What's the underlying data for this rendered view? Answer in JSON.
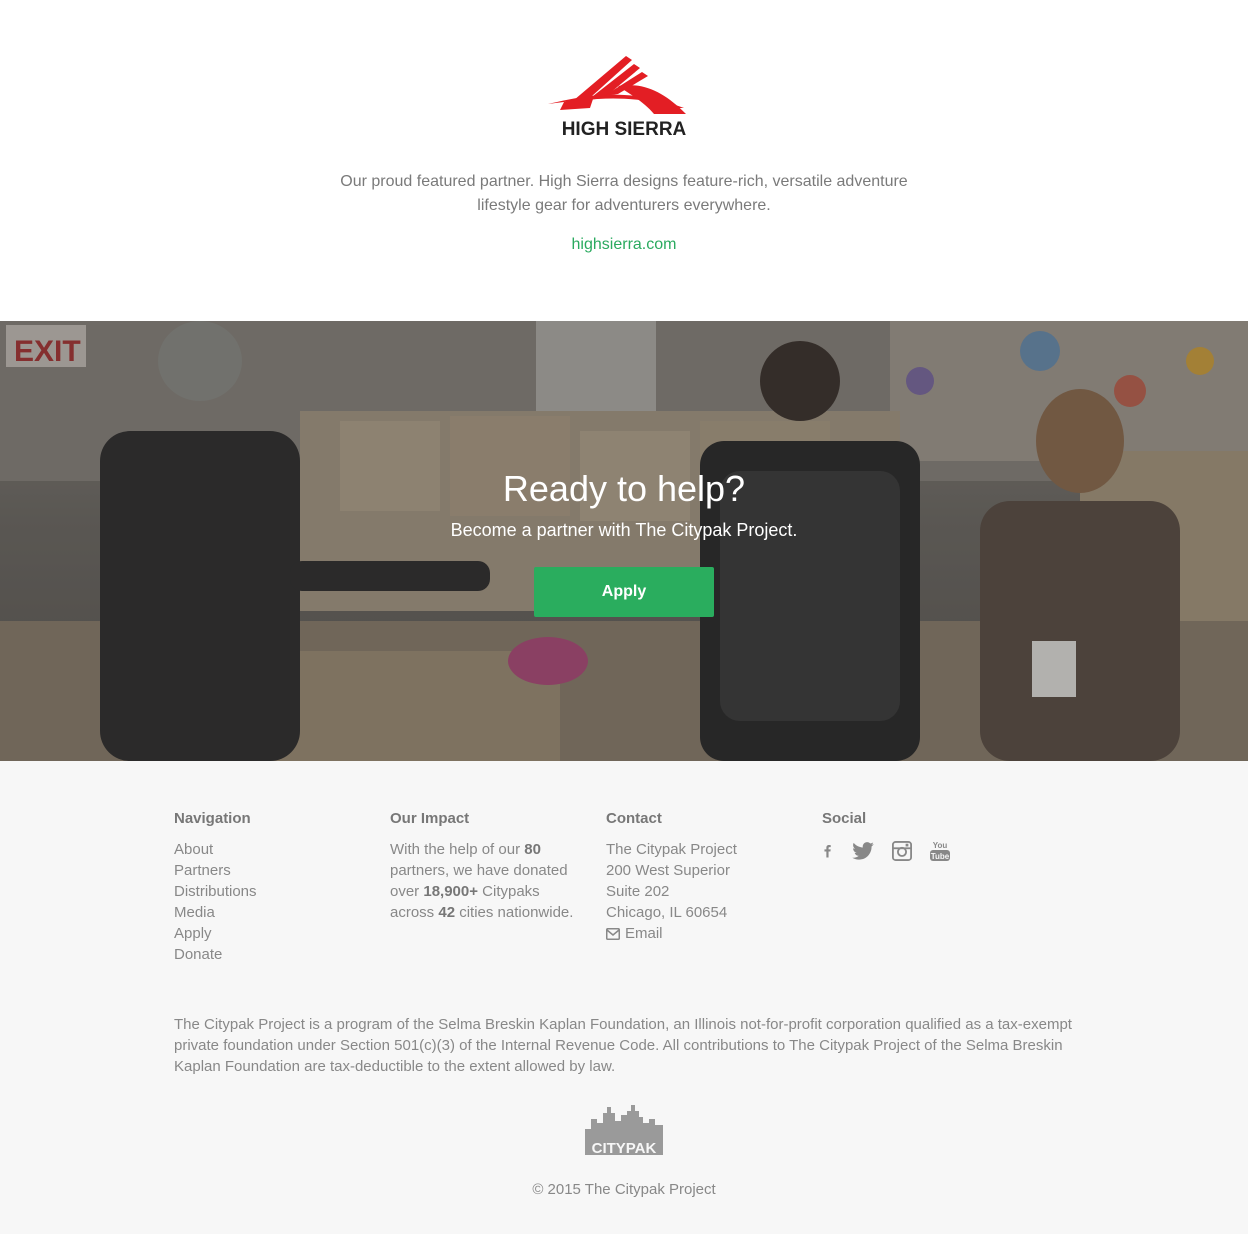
{
  "partner": {
    "logo_text": "HIGH SIERRA",
    "description": "Our proud featured partner. High Sierra designs feature-rich, versatile adventure lifestyle gear for adventurers everywhere.",
    "link": "highsierra.com"
  },
  "hero": {
    "title": "Ready to help?",
    "subtitle": "Become a partner with The Citypak Project.",
    "button": "Apply"
  },
  "footer": {
    "navigation": {
      "heading": "Navigation",
      "items": [
        "About",
        "Partners",
        "Distributions",
        "Media",
        "Apply",
        "Donate"
      ]
    },
    "impact": {
      "heading": "Our Impact",
      "t1": "With the help of our ",
      "partners_count": "80",
      "t2": " partners, we have donated over ",
      "citypaks_count": "18,900+",
      "t3": " Citypaks across ",
      "cities_count": "42",
      "t4": " cities nationwide."
    },
    "contact": {
      "heading": "Contact",
      "lines": [
        "The Citypak Project",
        "200 West Superior",
        "Suite 202",
        "Chicago, IL 60654"
      ],
      "email": "Email"
    },
    "social": {
      "heading": "Social",
      "icons": [
        "facebook-icon",
        "twitter-icon",
        "instagram-icon",
        "youtube-icon"
      ]
    },
    "legal": "The Citypak Project is a program of the Selma Breskin Kaplan Foundation, an Illinois not-for-profit corporation qualified as a tax-exempt private foundation under Section 501(c)(3) of the Internal Revenue Code. All contributions to The Citypak Project of the Selma Breskin Kaplan Foundation are tax-deductible to the extent allowed by law.",
    "logo_text": "CITYPAK",
    "copyright": "© 2015 The Citypak Project"
  },
  "colors": {
    "accent_green": "#2aad5e",
    "brand_red": "#e31e24",
    "footer_bg": "#f7f7f7"
  }
}
